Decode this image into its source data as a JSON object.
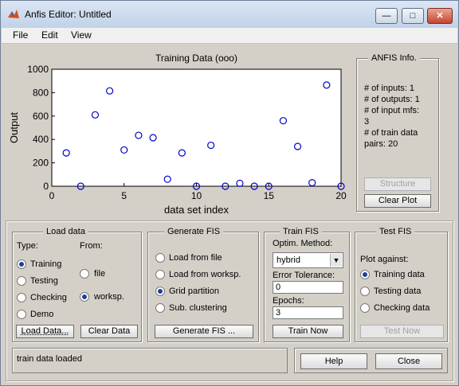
{
  "window": {
    "title": "Anfis Editor: Untitled",
    "min_label": "—",
    "max_label": "□",
    "close_label": "✕"
  },
  "menu": {
    "items": [
      "File",
      "Edit",
      "View"
    ]
  },
  "chart_data": {
    "type": "scatter",
    "title": "Training Data (ooo)",
    "xlabel": "data set index",
    "ylabel": "Output",
    "xlim": [
      0,
      20
    ],
    "ylim": [
      0,
      1000
    ],
    "xticks": [
      0,
      5,
      10,
      15,
      20
    ],
    "yticks": [
      0,
      200,
      400,
      600,
      800,
      1000
    ],
    "marker_color": "#0000cc",
    "x": [
      1,
      2,
      3,
      4,
      5,
      6,
      7,
      8,
      9,
      10,
      11,
      12,
      13,
      14,
      15,
      16,
      17,
      18,
      19,
      20
    ],
    "y": [
      285,
      0,
      610,
      815,
      310,
      435,
      415,
      60,
      285,
      0,
      350,
      0,
      25,
      0,
      0,
      560,
      340,
      30,
      865,
      0
    ]
  },
  "anfis_info": {
    "title": "ANFIS Info.",
    "lines": [
      "# of inputs: 1",
      "# of outputs: 1",
      "# of input mfs:",
      "3",
      "# of train data",
      "pairs: 20"
    ],
    "structure_label": "Structure",
    "clear_plot_label": "Clear Plot"
  },
  "load_data": {
    "title": "Load data",
    "type_label": "Type:",
    "from_label": "From:",
    "types": [
      "Training",
      "Testing",
      "Checking",
      "Demo"
    ],
    "sources": [
      "file",
      "worksp."
    ],
    "load_label": "Load Data...",
    "clear_label": "Clear Data"
  },
  "generate_fis": {
    "title": "Generate FIS",
    "options": [
      "Load from file",
      "Load from worksp.",
      "Grid partition",
      "Sub. clustering"
    ],
    "button_label": "Generate FIS ..."
  },
  "train_fis": {
    "title": "Train FIS",
    "method_label": "Optim. Method:",
    "method_value": "hybrid",
    "error_label": "Error Tolerance:",
    "error_value": "0",
    "epochs_label": "Epochs:",
    "epochs_value": "3",
    "button_label": "Train Now"
  },
  "test_fis": {
    "title": "Test FIS",
    "plot_against_label": "Plot against:",
    "options": [
      "Training data",
      "Testing data",
      "Checking data"
    ],
    "button_label": "Test Now"
  },
  "status": {
    "message": "train data loaded"
  },
  "footer": {
    "help_label": "Help",
    "close_label": "Close"
  }
}
